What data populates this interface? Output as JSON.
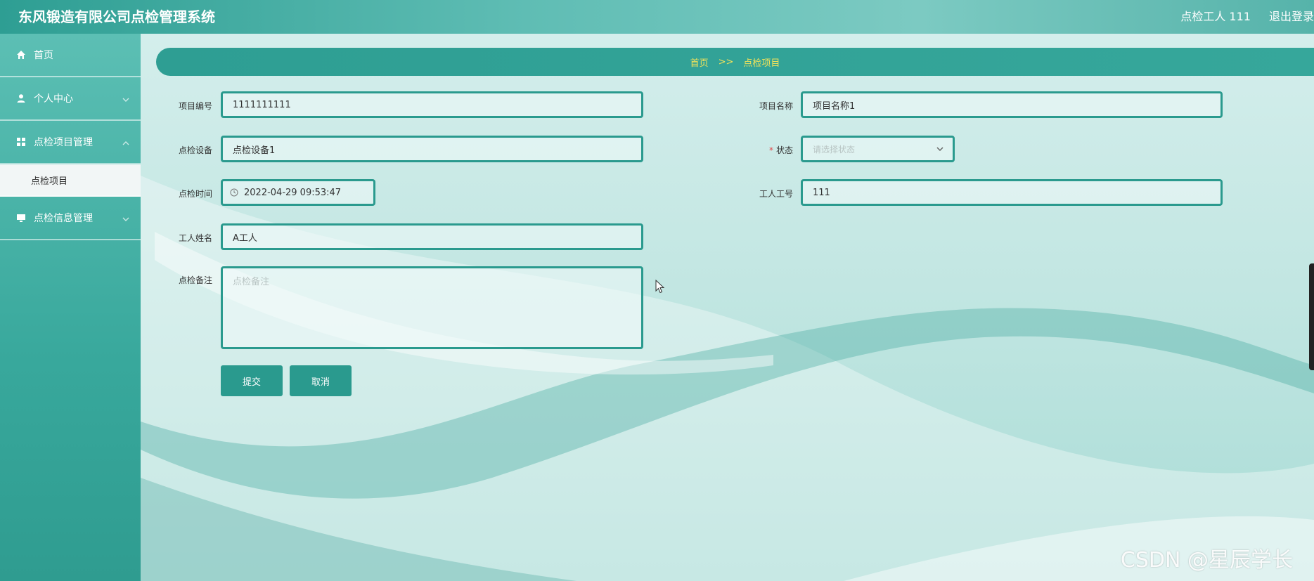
{
  "header": {
    "title": "东风锻造有限公司点检管理系统",
    "user": "点检工人 111",
    "logout": "退出登录"
  },
  "sidebar": {
    "items": [
      {
        "label": "首页",
        "icon": "home-icon"
      },
      {
        "label": "个人中心",
        "icon": "user-icon"
      },
      {
        "label": "点检项目管理",
        "icon": "grid-icon"
      },
      {
        "label": "点检信息管理",
        "icon": "monitor-icon"
      }
    ],
    "sub_item": "点检项目"
  },
  "breadcrumb": {
    "home": "首页",
    "separator": ">>",
    "current": "点检项目"
  },
  "form": {
    "project_no": {
      "label": "项目编号",
      "value": "1111111111"
    },
    "project_name": {
      "label": "项目名称",
      "value": "项目名称1"
    },
    "device": {
      "label": "点检设备",
      "value": "点检设备1"
    },
    "status": {
      "label": "状态",
      "required_mark": "*",
      "placeholder": "请选择状态"
    },
    "time": {
      "label": "点检时间",
      "value": "2022-04-29 09:53:47"
    },
    "worker_no": {
      "label": "工人工号",
      "value": "111"
    },
    "worker_name": {
      "label": "工人姓名",
      "value": "A工人"
    },
    "remark": {
      "label": "点检备注",
      "placeholder": "点检备注"
    },
    "submit": "提交",
    "cancel": "取消"
  },
  "watermark": "CSDN @星辰学长",
  "colors": {
    "accent": "#2a9a8e",
    "breadcrumb_text": "#f1e25a",
    "required": "#e24a4a"
  }
}
